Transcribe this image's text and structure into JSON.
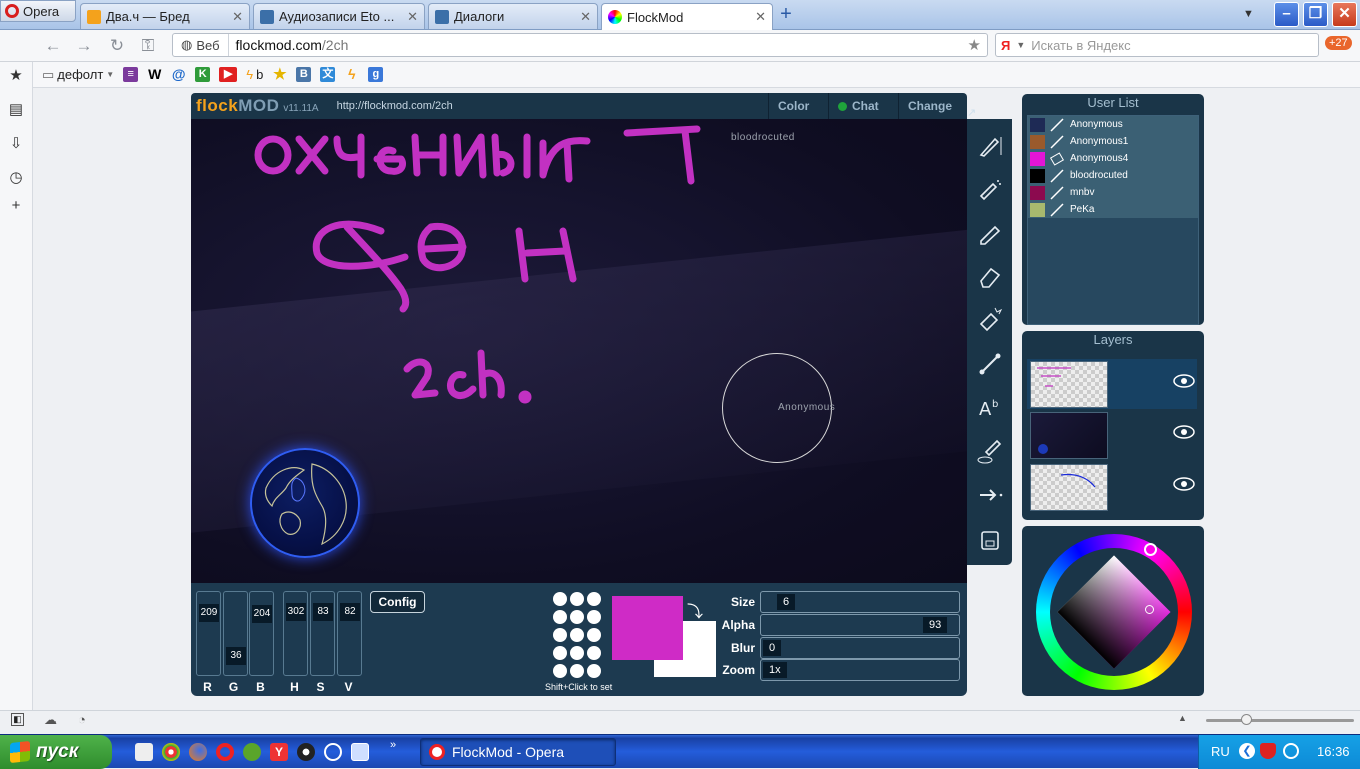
{
  "browser": {
    "menu_label": "Opera",
    "tabs": [
      {
        "title": "Два.ч — Бред",
        "color": "#f4a21c",
        "active": false
      },
      {
        "title": "Аудиозаписи Eto ...",
        "color": "#3b6fa8",
        "active": false
      },
      {
        "title": "Диалоги",
        "color": "#3b6fa8",
        "active": false
      },
      {
        "title": "FlockMod",
        "color": "#cc33cc",
        "active": true
      }
    ],
    "address": {
      "scope_label": "Веб",
      "domain": "flockmod.com",
      "path": "/2ch"
    },
    "search_placeholder": "Искать в Яндекс",
    "search_engine": "Я",
    "notification_count": "+27",
    "bookmarks": [
      {
        "label": "дефолт",
        "icon": "folder-icon"
      },
      {
        "label": "",
        "icon": "winrar-icon"
      },
      {
        "label": "W",
        "icon": "wikipedia-icon"
      },
      {
        "label": "@",
        "icon": "mail-icon"
      },
      {
        "label": "",
        "icon": "kaspersky-icon"
      },
      {
        "label": "",
        "icon": "youtube-icon"
      },
      {
        "label": "b",
        "icon": "dvach-icon"
      },
      {
        "label": "",
        "icon": "star-icon"
      },
      {
        "label": "В",
        "icon": "vk-icon"
      },
      {
        "label": "",
        "icon": "translate-icon"
      },
      {
        "label": "",
        "icon": "bolt-icon"
      },
      {
        "label": "g",
        "icon": "google-icon"
      }
    ]
  },
  "flockmod": {
    "logo_a": "flock",
    "logo_b": "MOD",
    "version": "v11.11A",
    "room_url": "http://flockmod.com/2ch",
    "header_tabs": [
      "Color",
      "Chat",
      "Change"
    ],
    "canvas_labels": {
      "author": "bloodrocuted",
      "cursor_user": "Anonymous"
    },
    "rgb": [
      {
        "label": "R",
        "value": "209"
      },
      {
        "label": "G",
        "value": "36"
      },
      {
        "label": "B",
        "value": "204"
      },
      {
        "label": "H",
        "value": "302"
      },
      {
        "label": "S",
        "value": "83"
      },
      {
        "label": "V",
        "value": "82"
      }
    ],
    "config_label": "Config",
    "brush_hint": "Shift+Click to set",
    "primary_color": "#cf2bc6",
    "secondary_color": "#ffffff",
    "settings": [
      {
        "label": "Size",
        "value": "6",
        "fraction": 0.06
      },
      {
        "label": "Alpha",
        "value": "93",
        "fraction": 0.93
      },
      {
        "label": "Blur",
        "value": "0",
        "fraction": 0.0
      },
      {
        "label": "Zoom",
        "value": "1x",
        "fraction": 0.0
      }
    ],
    "user_list_title": "User List",
    "users": [
      {
        "name": "Anonymous",
        "color": "#1e2a55"
      },
      {
        "name": "Anonymous1",
        "color": "#9a5a2c"
      },
      {
        "name": "Anonymous4",
        "color": "#e415d6"
      },
      {
        "name": "bloodrocuted",
        "color": "#000000"
      },
      {
        "name": "mnbv",
        "color": "#8c0a4f"
      },
      {
        "name": "PeKa",
        "color": "#a8b96e"
      }
    ],
    "layers_title": "Layers"
  },
  "status_bar": {},
  "taskbar": {
    "start_label": "пуск",
    "task_title": "FlockMod - Opera",
    "language": "RU",
    "clock": "16:36"
  }
}
